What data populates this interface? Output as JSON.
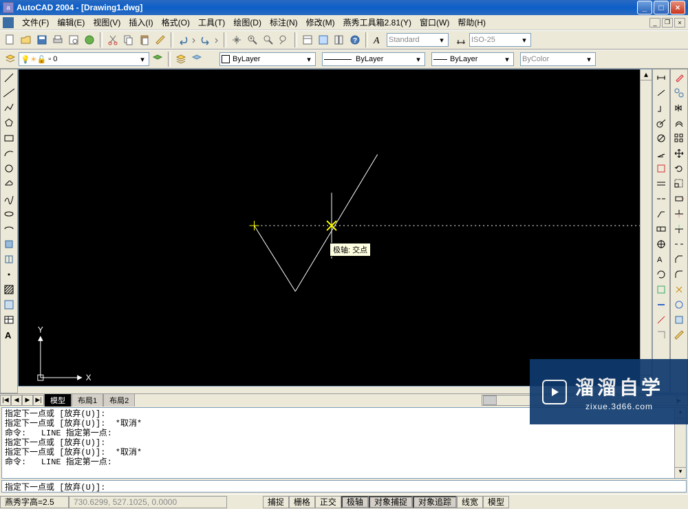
{
  "title": "AutoCAD 2004 - [Drawing1.dwg]",
  "menus": [
    "文件(F)",
    "编辑(E)",
    "视图(V)",
    "插入(I)",
    "格式(O)",
    "工具(T)",
    "绘图(D)",
    "标注(N)",
    "修改(M)",
    "燕秀工具箱2.81(Y)",
    "窗口(W)",
    "帮助(H)"
  ],
  "toolbar2": {
    "layer_value": "0",
    "text_style": "Standard",
    "dim_style": "ISO-25"
  },
  "toolbar3": {
    "linetype": "ByLayer",
    "lineweight": "ByLayer",
    "linetype2": "ByLayer",
    "color": "ByColor"
  },
  "canvas": {
    "tooltip": "极轴: 交点",
    "ucs_x": "X",
    "ucs_y": "Y"
  },
  "tabs": {
    "nav": [
      "|◀",
      "◀",
      "▶",
      "▶|"
    ],
    "items": [
      "模型",
      "布局1",
      "布局2"
    ],
    "active": 0
  },
  "command_history": "指定下一点或 [放弃(U)]:\n指定下一点或 [放弃(U)]:  *取消*\n命令:   LINE 指定第一点:\n指定下一点或 [放弃(U)]:\n指定下一点或 [放弃(U)]:  *取消*\n命令:   LINE 指定第一点:",
  "command_prompt": "指定下一点或 [放弃(U)]:",
  "status": {
    "left": "燕秀字高=2.5",
    "coords": "730.6299,  527.1025,  0.0000",
    "toggles": [
      "捕捉",
      "栅格",
      "正交",
      "极轴",
      "对象捕捉",
      "对象追踪",
      "线宽",
      "模型"
    ],
    "pressed": [
      false,
      false,
      false,
      true,
      true,
      true,
      false,
      false
    ]
  },
  "watermark": {
    "big": "溜溜自学",
    "small": "zixue.3d66.com"
  },
  "left_tools": [
    "line",
    "construction-line",
    "polyline",
    "polygon",
    "rectangle",
    "arc",
    "circle",
    "revision-cloud",
    "spline",
    "ellipse",
    "ellipse-arc",
    "insert-block",
    "make-block",
    "point",
    "hatch",
    "region",
    "table",
    "mtext"
  ],
  "right_tools_a": [
    "distance",
    "area",
    "mass",
    "list",
    "locate",
    "time",
    "status"
  ],
  "right_tools_b": [
    "pan",
    "zoom-realtime",
    "zoom-window",
    "zoom-prev",
    "redraw",
    "regen"
  ],
  "right_tools_c": [
    "dim-linear",
    "dim-aligned",
    "dim-ordinate",
    "dim-radius",
    "dim-diameter",
    "dim-angular"
  ],
  "right_tools_d": [
    "erase",
    "copy",
    "mirror",
    "offset",
    "array",
    "move",
    "rotate",
    "scale",
    "stretch",
    "trim",
    "extend",
    "break",
    "chamfer",
    "fillet",
    "explode"
  ]
}
